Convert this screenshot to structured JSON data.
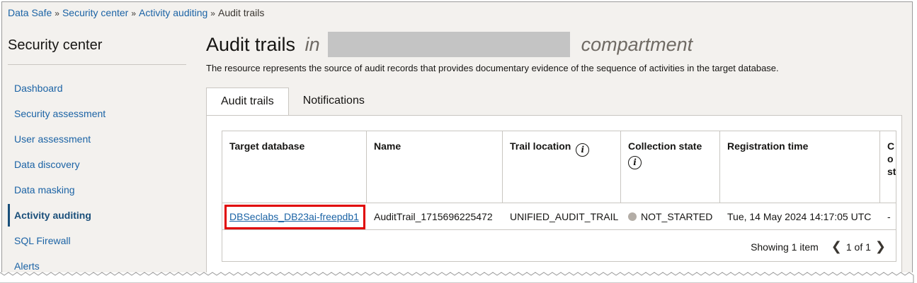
{
  "breadcrumb": [
    {
      "label": "Data Safe",
      "link": true
    },
    {
      "label": "Security center",
      "link": true
    },
    {
      "label": "Activity auditing",
      "link": true
    },
    {
      "label": "Audit trails",
      "link": false
    }
  ],
  "breadcrumb_separator": "»",
  "sidebar": {
    "title": "Security center",
    "items": [
      {
        "label": "Dashboard",
        "active": false
      },
      {
        "label": "Security assessment",
        "active": false
      },
      {
        "label": "User assessment",
        "active": false
      },
      {
        "label": "Data discovery",
        "active": false
      },
      {
        "label": "Data masking",
        "active": false
      },
      {
        "label": "Activity auditing",
        "active": true
      },
      {
        "label": "SQL Firewall",
        "active": false
      },
      {
        "label": "Alerts",
        "active": false
      }
    ]
  },
  "page": {
    "title": "Audit trails",
    "title_in": "in",
    "title_suffix": "compartment",
    "description": "The resource represents the source of audit records that provides documentary evidence of the sequence of activities in the target database."
  },
  "tabs": [
    {
      "label": "Audit trails",
      "active": true
    },
    {
      "label": "Notifications",
      "active": false
    }
  ],
  "table": {
    "columns": [
      {
        "label": "Target database",
        "info": false
      },
      {
        "label": "Name",
        "info": false
      },
      {
        "label": "Trail location",
        "info": true
      },
      {
        "label": "Collection state",
        "info": true
      },
      {
        "label": "Registration time",
        "info": false
      },
      {
        "label": "Co st",
        "info": false
      }
    ],
    "rows": [
      {
        "target_database": "DBSeclabs_DB23ai-freepdb1",
        "name": "AuditTrail_1715696225472",
        "trail_location": "UNIFIED_AUDIT_TRAIL",
        "collection_state": "NOT_STARTED",
        "registration_time": "Tue, 14 May 2024 14:17:05 UTC",
        "last_col": "-"
      }
    ]
  },
  "pagination": {
    "summary": "Showing 1 item",
    "page": "1 of 1"
  },
  "colors": {
    "link": "#1b63a5",
    "active_nav": "#1a4f7a",
    "highlight": "#e00000",
    "state_dot": "#b3ada6"
  }
}
